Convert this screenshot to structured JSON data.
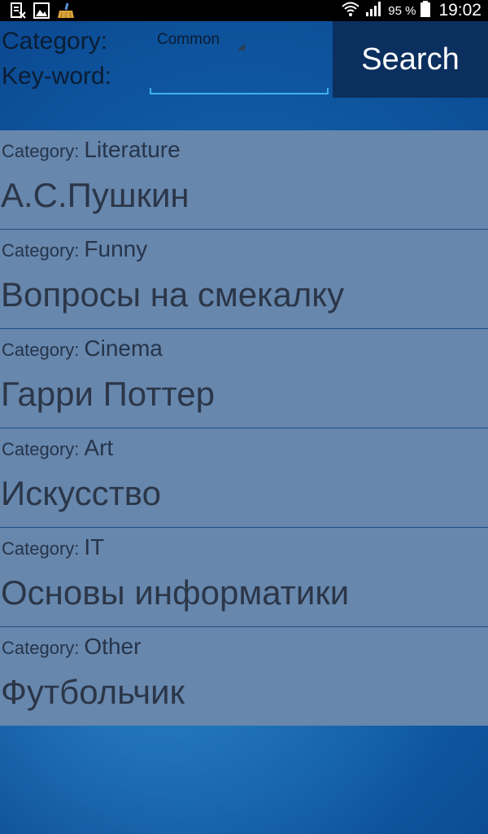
{
  "status_bar": {
    "left_icons": [
      "sim-card-icon",
      "image-icon",
      "cleaner-broom-icon"
    ],
    "right_icons": [
      "wifi-icon",
      "signal-icon",
      "battery-icon"
    ],
    "battery_text": "95 %",
    "time": "19:02"
  },
  "form": {
    "category_label": "Category:",
    "keyword_label": "Key-word:",
    "category_value": "Common",
    "keyword_value": "",
    "search_label": "Search"
  },
  "results": {
    "category_prefix": "Category:",
    "items": [
      {
        "category": "Literature",
        "title": "А.С.Пушкин"
      },
      {
        "category": "Funny",
        "title": "Вопросы на смекалку"
      },
      {
        "category": "Cinema",
        "title": "Гарри Поттер"
      },
      {
        "category": "Art",
        "title": "Искусство"
      },
      {
        "category": "IT",
        "title": "Основы информатики"
      },
      {
        "category": "Other",
        "title": "Футбольчик"
      }
    ]
  },
  "colors": {
    "status_bar": "#000000",
    "search_button": "#0b2f5f",
    "list_background": "#6787ad",
    "input_underline": "#3fb0ea",
    "background": "#0f5aa2"
  }
}
